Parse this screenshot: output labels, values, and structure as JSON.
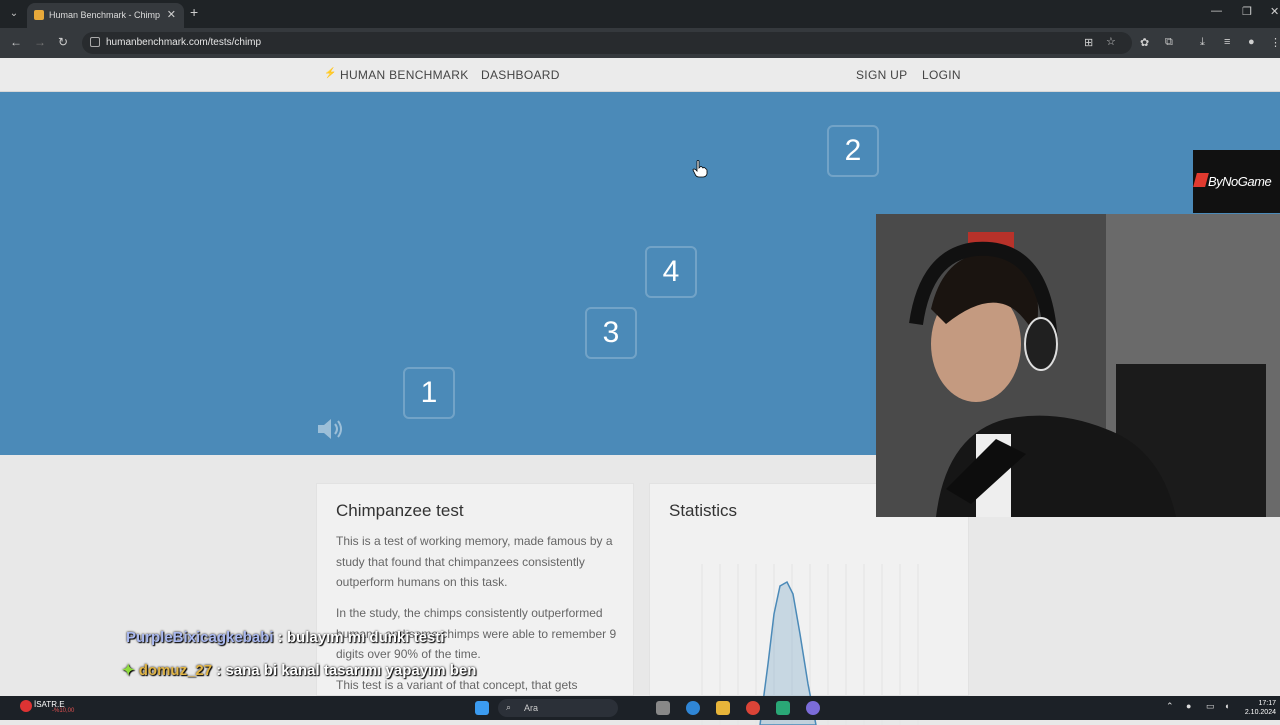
{
  "browser": {
    "tab_title": "Human Benchmark - Chimp Test",
    "new_tab": "+",
    "url": "humanbenchmark.com/tests/chimp"
  },
  "site_nav": {
    "brand": "HUMAN BENCHMARK",
    "dashboard": "DASHBOARD",
    "signup": "SIGN UP",
    "login": "LOGIN"
  },
  "test": {
    "cells": [
      {
        "number": "2"
      },
      {
        "number": "4"
      },
      {
        "number": "3"
      },
      {
        "number": "1"
      }
    ]
  },
  "about": {
    "title": "Chimpanzee test",
    "p1": "This is a test of working memory, made famous by a study that found that chimpanzees consistently outperform humans on this task.",
    "p2": "In the study, the chimps consistently outperformed humans, and some chimps were able to remember 9 digits over 90% of the time.",
    "p3": "This test is a variant of that concept, that gets"
  },
  "statistics": {
    "title": "Statistics"
  },
  "stream": {
    "brand": "ByNoGame",
    "chat": [
      {
        "user": "PurpleBixicagkebabi",
        "message": ": bulayım mı dunki testi"
      },
      {
        "user": "domuz_27",
        "message": ": sana bi kanal tasarımı yapayım ben"
      }
    ]
  },
  "taskbar": {
    "weather_label": "İSATR.E",
    "weather_sub": "-%10,00",
    "search_placeholder": "Ara",
    "time": "17:17",
    "date": "2.10.2024"
  },
  "colors": {
    "test_bg": "#4b8ab8",
    "page_bg": "#e8e8e8"
  }
}
